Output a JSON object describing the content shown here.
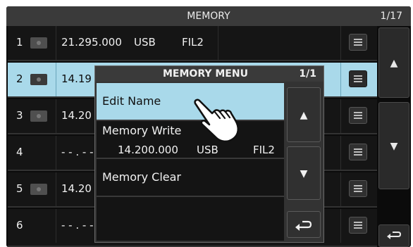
{
  "header": {
    "title": "MEMORY",
    "page": "1/17"
  },
  "rows": [
    {
      "num": "1",
      "freq": "21.295.000",
      "mode": "USB",
      "filter": "FIL2"
    },
    {
      "num": "2",
      "freq": "14.19"
    },
    {
      "num": "3",
      "freq": "14.20"
    },
    {
      "num": "4",
      "freq": "- - . - -"
    },
    {
      "num": "5",
      "freq": "14.20"
    },
    {
      "num": "6",
      "freq": "- - . - -"
    }
  ],
  "dialog": {
    "title": "MEMORY MENU",
    "page": "1/1",
    "items": [
      {
        "label": "Edit Name"
      },
      {
        "label": "Memory Write",
        "freq": "14.200.000",
        "mode": "USB",
        "filter": "FIL2"
      },
      {
        "label": "Memory Clear"
      }
    ]
  },
  "icons": {
    "row_menu": "menu-icon",
    "scroll_up": "up-triangle-icon",
    "scroll_down": "down-triangle-icon",
    "back": "return-arrow-icon",
    "pointer": "hand-pointer-icon"
  },
  "colors": {
    "selection": "#a9d9ea",
    "background": "#0b0b0b"
  }
}
